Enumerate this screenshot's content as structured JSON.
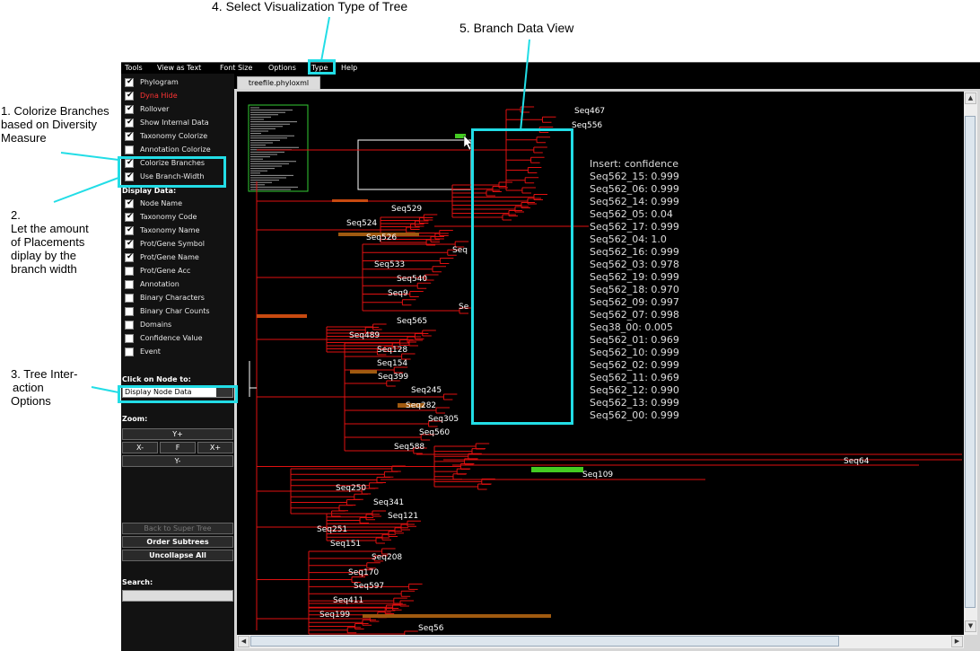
{
  "annotations": {
    "step1": [
      "1. Colorize Branches",
      "based on  Diversity",
      "Measure"
    ],
    "step2": [
      "2.",
      "Let the amount",
      "of Placements",
      "diplay by the",
      "branch width"
    ],
    "step3": [
      "3. Tree Inter-",
      "action",
      "Options"
    ],
    "step4": "4. Select Visualization Type of Tree",
    "step5": "5. Branch Data View"
  },
  "menu": [
    "Tools",
    "View as Text",
    "Font Size",
    "Options",
    "Type",
    "Help"
  ],
  "sidebar": {
    "options": [
      {
        "label": "Phylogram",
        "checked": true
      },
      {
        "label": "Dyna Hide",
        "checked": true,
        "red": true
      },
      {
        "label": "Rollover",
        "checked": true
      },
      {
        "label": "Show Internal Data",
        "checked": true
      },
      {
        "label": "Taxonomy Colorize",
        "checked": true
      },
      {
        "label": "Annotation Colorize",
        "checked": false
      },
      {
        "label": "Colorize Branches",
        "checked": true
      },
      {
        "label": "Use Branch-Width",
        "checked": true
      }
    ],
    "display_data_heading": "Display Data:",
    "display_data": [
      {
        "label": "Node Name",
        "checked": true
      },
      {
        "label": "Taxonomy Code",
        "checked": true
      },
      {
        "label": "Taxonomy Name",
        "checked": true
      },
      {
        "label": "Prot/Gene Symbol",
        "checked": true
      },
      {
        "label": "Prot/Gene Name",
        "checked": true
      },
      {
        "label": "Prot/Gene Acc",
        "checked": false
      },
      {
        "label": "Annotation",
        "checked": false
      },
      {
        "label": "Binary Characters",
        "checked": false
      },
      {
        "label": "Binary Char Counts",
        "checked": false
      },
      {
        "label": "Domains",
        "checked": false
      },
      {
        "label": "Confidence Value",
        "checked": false
      },
      {
        "label": "Event",
        "checked": false
      }
    ],
    "click_heading": "Click on Node to:",
    "click_value": "Display Node Data",
    "zoom_heading": "Zoom:",
    "zoom": {
      "y_plus": "Y+",
      "x_minus": "X-",
      "fit": "F",
      "x_plus": "X+",
      "y_minus": "Y-"
    },
    "back_to_super": "Back to Super Tree",
    "order_subtrees": "Order Subtrees",
    "uncollapse_all": "Uncollapse All",
    "search_heading": "Search:",
    "search_value": ""
  },
  "tab": "treefile.phyloxml",
  "popup": {
    "lines": [
      "Insert: confidence",
      "Seq562_15: 0.999",
      "Seq562_06: 0.999",
      "Seq562_14: 0.999",
      "Seq562_05: 0.04",
      "Seq562_17: 0.999",
      "Seq562_04: 1.0",
      "Seq562_16: 0.999",
      "Seq562_03: 0.978",
      "Seq562_19: 0.999",
      "Seq562_18: 0.970",
      "Seq562_09: 0.997",
      "Seq562_07: 0.998",
      "Seq38_00: 0.005",
      "Seq562_01: 0.969",
      "Seq562_10: 0.999",
      "Seq562_02: 0.999",
      "Seq562_11: 0.969",
      "Seq562_12: 0.990",
      "Seq562_13: 0.999",
      "Seq562_00: 0.999"
    ]
  },
  "tree_labels": [
    "Seq467",
    "Seq556",
    "Seq529",
    "Seq524",
    "Seq526",
    "Seq",
    "Seq533",
    "Seq540",
    "Seq9",
    "Se",
    "Seq565",
    "Seq489",
    "Seq128",
    "Seq154",
    "Seq399",
    "Seq245",
    "Seq282",
    "Seq305",
    "Seq560",
    "Seq588",
    "Seq64",
    "Seq109",
    "Seq250",
    "Seq341",
    "Seq121",
    "Seq251",
    "Seq151",
    "Seq208",
    "Seq170",
    "Seq597",
    "Seq411",
    "Seq199",
    "Seq56"
  ],
  "colors": {
    "branch": "#e01010",
    "accent_callout": "#22dde6",
    "highlight_green": "#44cc22",
    "highlight_brown": "#a05a10",
    "highlight_orange": "#c84a10"
  }
}
